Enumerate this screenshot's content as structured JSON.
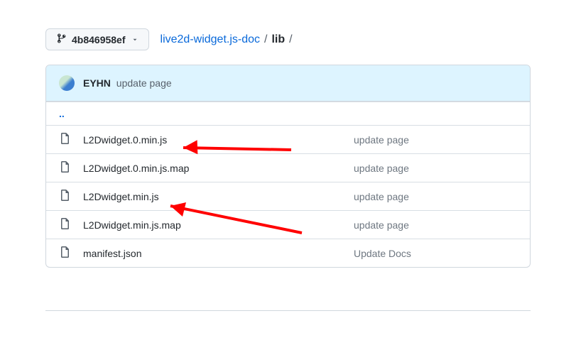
{
  "branch": {
    "label": "4b846958ef"
  },
  "breadcrumb": {
    "repo": "live2d-widget.js-doc",
    "path": "lib",
    "sep": "/"
  },
  "commit_header": {
    "author": "EYHN",
    "message": "update page"
  },
  "uplink": "..",
  "files": [
    {
      "name": "L2Dwidget.0.min.js",
      "commit": "update page"
    },
    {
      "name": "L2Dwidget.0.min.js.map",
      "commit": "update page"
    },
    {
      "name": "L2Dwidget.min.js",
      "commit": "update page"
    },
    {
      "name": "L2Dwidget.min.js.map",
      "commit": "update page"
    },
    {
      "name": "manifest.json",
      "commit": "Update Docs"
    }
  ]
}
